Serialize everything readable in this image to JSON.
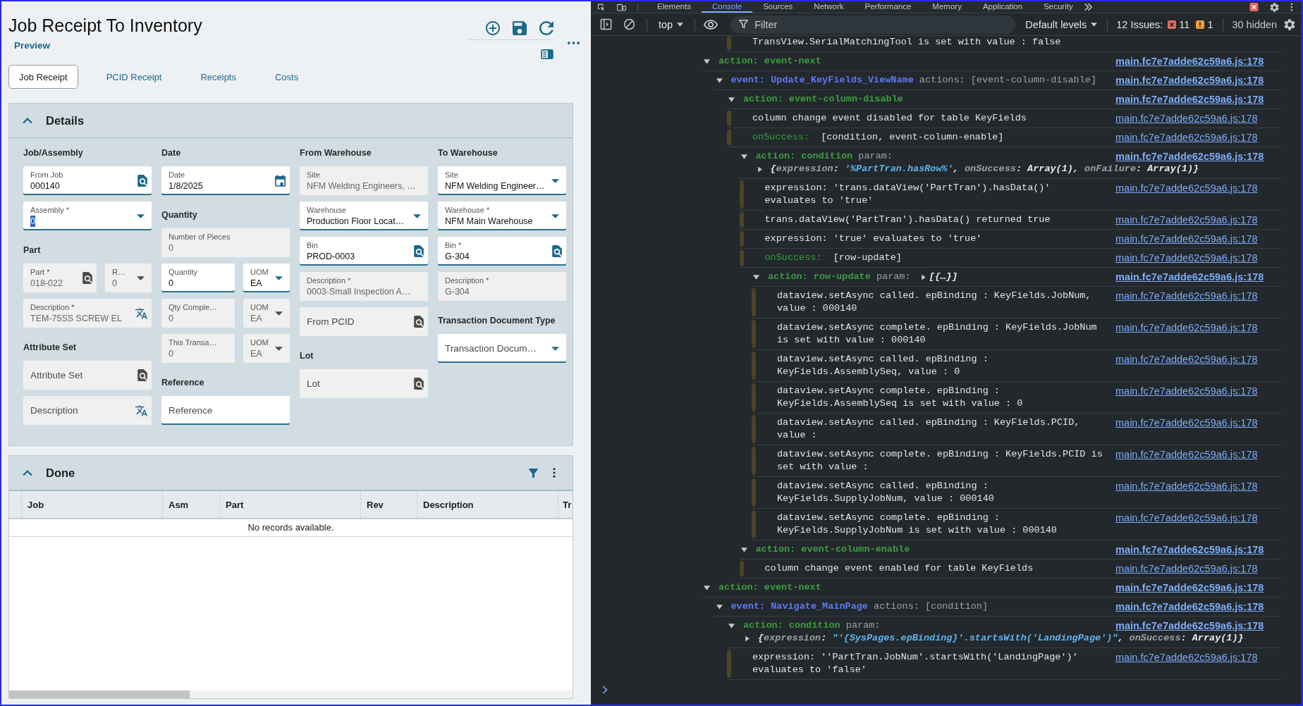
{
  "app": {
    "title": "Job Receipt To Inventory",
    "subtitle": "Preview",
    "tabs": [
      {
        "label": "Job Receipt",
        "selected": true
      },
      {
        "label": "PCID Receipt",
        "selected": false
      },
      {
        "label": "Receipts",
        "selected": false
      },
      {
        "label": "Costs",
        "selected": false
      }
    ],
    "details": {
      "title": "Details",
      "expanded": true,
      "columns": [
        {
          "sections": [
            {
              "heading": "Job/Assembly",
              "rows": [
                {
                  "fields": [
                    {
                      "kind": "lookup",
                      "label": "From Job",
                      "value": "000140",
                      "disabled": false,
                      "text_selected": false
                    }
                  ]
                },
                {
                  "fields": [
                    {
                      "kind": "dropdown",
                      "label": "Assembly *",
                      "value": "0",
                      "disabled": false,
                      "text_selected": true
                    }
                  ]
                }
              ]
            },
            {
              "heading": "Part",
              "rows": [
                {
                  "fields": [
                    {
                      "kind": "lookup",
                      "label": "Part *",
                      "value": "018-022",
                      "disabled": true,
                      "text_selected": false
                    },
                    {
                      "kind": "dropdown",
                      "label": "R…",
                      "value": "0",
                      "disabled": true,
                      "text_selected": false
                    }
                  ]
                },
                {
                  "fields": [
                    {
                      "kind": "translate",
                      "label": "Description *",
                      "value": "TEM-75SS SCREW EL",
                      "disabled": true,
                      "text_selected": false
                    }
                  ]
                }
              ]
            },
            {
              "heading": "Attribute Set",
              "rows": [
                {
                  "fields": [
                    {
                      "kind": "lookup",
                      "placeholder": "Attribute Set",
                      "disabled": true
                    }
                  ]
                },
                {
                  "fields": [
                    {
                      "kind": "translate",
                      "placeholder": "Description",
                      "disabled": true
                    }
                  ]
                }
              ]
            }
          ]
        },
        {
          "sections": [
            {
              "heading": "Date",
              "rows": [
                {
                  "fields": [
                    {
                      "kind": "date",
                      "label": "Date",
                      "value": "1/8/2025",
                      "disabled": false,
                      "text_selected": false
                    }
                  ]
                }
              ]
            },
            {
              "heading": "Quantity",
              "rows": [
                {
                  "fields": [
                    {
                      "kind": "text",
                      "label": "Number of Pieces",
                      "value": "0",
                      "disabled": true,
                      "text_selected": false
                    }
                  ]
                },
                {
                  "fields": [
                    {
                      "kind": "text",
                      "label": "Quantity",
                      "value": "0",
                      "disabled": false,
                      "text_selected": false
                    },
                    {
                      "kind": "dropdown",
                      "label": "UOM",
                      "value": "EA",
                      "disabled": false,
                      "text_selected": false
                    }
                  ]
                },
                {
                  "fields": [
                    {
                      "kind": "text",
                      "label": "Qty Comple…",
                      "value": "0",
                      "disabled": true,
                      "text_selected": false
                    },
                    {
                      "kind": "dropdown",
                      "label": "UOM",
                      "value": "EA",
                      "disabled": true,
                      "text_selected": false
                    }
                  ]
                },
                {
                  "fields": [
                    {
                      "kind": "text",
                      "label": "This Transa…",
                      "value": "0",
                      "disabled": true,
                      "text_selected": false
                    },
                    {
                      "kind": "dropdown",
                      "label": "UOM",
                      "value": "EA",
                      "disabled": true,
                      "text_selected": false
                    }
                  ]
                }
              ]
            },
            {
              "heading": "Reference",
              "rows": [
                {
                  "fields": [
                    {
                      "kind": "text",
                      "placeholder": "Reference",
                      "disabled": false
                    }
                  ]
                }
              ]
            }
          ]
        },
        {
          "sections": [
            {
              "heading": "From Warehouse",
              "rows": [
                {
                  "fields": [
                    {
                      "kind": "text",
                      "label": "Site",
                      "value": "NFM Welding Engineers, …",
                      "disabled": true,
                      "text_selected": false
                    }
                  ]
                },
                {
                  "fields": [
                    {
                      "kind": "dropdown",
                      "label": "Warehouse",
                      "value": "Production Floor Locat…",
                      "disabled": false,
                      "text_selected": false
                    }
                  ]
                },
                {
                  "fields": [
                    {
                      "kind": "lookup",
                      "label": "Bin",
                      "value": "PROD-0003",
                      "disabled": false,
                      "text_selected": false
                    }
                  ]
                },
                {
                  "fields": [
                    {
                      "kind": "text",
                      "label": "Description *",
                      "value": "0003-Small Inspection A…",
                      "disabled": true,
                      "text_selected": false
                    }
                  ]
                },
                {
                  "fields": [
                    {
                      "kind": "lookup",
                      "placeholder": "From PCID",
                      "disabled": true
                    }
                  ]
                }
              ]
            },
            {
              "heading": "Lot",
              "rows": [
                {
                  "fields": [
                    {
                      "kind": "lookup",
                      "placeholder": "Lot",
                      "disabled": true
                    }
                  ]
                }
              ]
            }
          ]
        },
        {
          "sections": [
            {
              "heading": "To Warehouse",
              "rows": [
                {
                  "fields": [
                    {
                      "kind": "dropdown",
                      "label": "Site",
                      "value": "NFM Welding Engineer…",
                      "disabled": false,
                      "text_selected": false
                    }
                  ]
                },
                {
                  "fields": [
                    {
                      "kind": "dropdown",
                      "label": "Warehouse *",
                      "value": "NFM Main Warehouse",
                      "disabled": false,
                      "text_selected": false
                    }
                  ]
                },
                {
                  "fields": [
                    {
                      "kind": "lookup",
                      "label": "Bin *",
                      "value": "G-304",
                      "disabled": false,
                      "text_selected": false
                    }
                  ]
                },
                {
                  "fields": [
                    {
                      "kind": "text",
                      "label": "Description *",
                      "value": "G-304",
                      "disabled": true,
                      "text_selected": false
                    }
                  ]
                }
              ]
            },
            {
              "heading": "Transaction Document Type",
              "rows": [
                {
                  "fields": [
                    {
                      "kind": "dropdown",
                      "placeholder": "Transaction Docum…",
                      "disabled": false
                    }
                  ]
                }
              ]
            }
          ]
        }
      ]
    },
    "done": {
      "title": "Done",
      "expanded": true,
      "columns": [
        "Job",
        "Asm",
        "Part",
        "Rev",
        "Description",
        "Tr"
      ],
      "empty_text": "No records available."
    }
  },
  "devtools": {
    "tabs": [
      {
        "label": "Elements",
        "selected": false
      },
      {
        "label": "Console",
        "selected": true
      },
      {
        "label": "Sources",
        "selected": false
      },
      {
        "label": "Network",
        "selected": false
      },
      {
        "label": "Performance",
        "selected": false
      },
      {
        "label": "Memory",
        "selected": false
      },
      {
        "label": "Application",
        "selected": false
      },
      {
        "label": "Security",
        "selected": false
      }
    ],
    "toolbar": {
      "context": "top",
      "filter_placeholder": "Filter",
      "levels": "Default levels",
      "issues": {
        "label": "12 Issues:",
        "counts": [
          {
            "kind": "error",
            "count": "11"
          },
          {
            "kind": "warning",
            "count": "1"
          }
        ]
      },
      "hidden": "30 hidden"
    },
    "console": {
      "entries": [
        {
          "kind": "continued",
          "children": [
            {
              "kind": "continued",
              "children": [
                {
                  "kind": "continued",
                  "children": [
                    {
                      "kind": "log",
                      "text": "TransView.SerialMatchingTool is set with value : false"
                    }
                  ]
                }
              ]
            }
          ]
        },
        {
          "kind": "action",
          "label": "action: event-next",
          "expanded": true,
          "source": "main.fc7e7adde62c59a6.js:178",
          "children": [
            {
              "kind": "event",
              "label": "event: Update_KeyFields_ViewName",
              "suffix": "actions: [event-column-disable]",
              "expanded": true,
              "source": "main.fc7e7adde62c59a6.js:178",
              "children": [
                {
                  "kind": "action",
                  "label": "action: event-column-disable",
                  "expanded": true,
                  "source": "main.fc7e7adde62c59a6.js:178",
                  "children": [
                    {
                      "kind": "log",
                      "text": "column change event disabled for table KeyFields",
                      "source": "main.fc7e7adde62c59a6.js:178"
                    },
                    {
                      "kind": "success",
                      "key": "onSuccess:",
                      "text": "[condition, event-column-enable]",
                      "source": "main.fc7e7adde62c59a6.js:178"
                    },
                    {
                      "kind": "action",
                      "label": "action: condition",
                      "suffix": "param:",
                      "param": {
                        "kind": "block",
                        "expanded": false,
                        "segments": [
                          {
                            "kind": "plain",
                            "text": "{"
                          },
                          {
                            "kind": "key",
                            "text": "expression"
                          },
                          {
                            "kind": "plain",
                            "text": ": "
                          },
                          {
                            "kind": "string",
                            "text": "'%PartTran.hasRow%'"
                          },
                          {
                            "kind": "plain",
                            "text": ", "
                          },
                          {
                            "kind": "key",
                            "text": "onSuccess"
                          },
                          {
                            "kind": "plain",
                            "text": ": Array(1), "
                          },
                          {
                            "kind": "key",
                            "text": "onFailure"
                          },
                          {
                            "kind": "plain",
                            "text": ": Array(1)}"
                          }
                        ]
                      },
                      "expanded": true,
                      "source": "main.fc7e7adde62c59a6.js:178",
                      "children": [
                        {
                          "kind": "log",
                          "text": "expression: 'trans.dataView('PartTran').hasData()'\nevaluates to 'true'",
                          "source": "main.fc7e7adde62c59a6.js:178"
                        },
                        {
                          "kind": "log",
                          "text": "trans.dataView('PartTran').hasData() returned true",
                          "source": "main.fc7e7adde62c59a6.js:178"
                        },
                        {
                          "kind": "log",
                          "text": "expression: 'true' evaluates to 'true'",
                          "source": "main.fc7e7adde62c59a6.js:178"
                        },
                        {
                          "kind": "success",
                          "key": "onSuccess:",
                          "text": "[row-update]",
                          "source": "main.fc7e7adde62c59a6.js:178"
                        },
                        {
                          "kind": "action",
                          "label": "action: row-update",
                          "suffix": "param:",
                          "param": {
                            "kind": "inline",
                            "expanded": false,
                            "segments": [
                              {
                                "kind": "plain",
                                "text": "[{…}]"
                              }
                            ]
                          },
                          "expanded": true,
                          "source": "main.fc7e7adde62c59a6.js:178",
                          "children": [
                            {
                              "kind": "log",
                              "text": "dataview.setAsync called. epBinding : KeyFields.JobNum,\nvalue : 000140",
                              "source": "main.fc7e7adde62c59a6.js:178"
                            },
                            {
                              "kind": "log",
                              "text": "dataview.setAsync complete. epBinding : KeyFields.JobNum\nis set with value : 000140",
                              "source": "main.fc7e7adde62c59a6.js:178"
                            },
                            {
                              "kind": "log",
                              "text": "dataview.setAsync called. epBinding :\nKeyFields.AssemblySeq, value : 0",
                              "source": "main.fc7e7adde62c59a6.js:178"
                            },
                            {
                              "kind": "log",
                              "text": "dataview.setAsync complete. epBinding :\nKeyFields.AssemblySeq is set with value : 0",
                              "source": "main.fc7e7adde62c59a6.js:178"
                            },
                            {
                              "kind": "log",
                              "text": "dataview.setAsync called. epBinding : KeyFields.PCID,\nvalue :",
                              "source": "main.fc7e7adde62c59a6.js:178"
                            },
                            {
                              "kind": "log",
                              "text": "dataview.setAsync complete. epBinding : KeyFields.PCID is\nset with value :",
                              "source": "main.fc7e7adde62c59a6.js:178"
                            },
                            {
                              "kind": "log",
                              "text": "dataview.setAsync called. epBinding :\nKeyFields.SupplyJobNum, value : 000140",
                              "source": "main.fc7e7adde62c59a6.js:178"
                            },
                            {
                              "kind": "log",
                              "text": "dataview.setAsync complete. epBinding :\nKeyFields.SupplyJobNum is set with value : 000140",
                              "source": "main.fc7e7adde62c59a6.js:178"
                            }
                          ]
                        }
                      ]
                    },
                    {
                      "kind": "action",
                      "label": "action: event-column-enable",
                      "expanded": true,
                      "source": "main.fc7e7adde62c59a6.js:178",
                      "children": [
                        {
                          "kind": "log",
                          "text": "column change event enabled for table KeyFields",
                          "source": "main.fc7e7adde62c59a6.js:178"
                        }
                      ]
                    }
                  ]
                }
              ]
            }
          ]
        },
        {
          "kind": "action",
          "label": "action: event-next",
          "expanded": true,
          "source": "main.fc7e7adde62c59a6.js:178",
          "children": [
            {
              "kind": "event",
              "label": "event: Navigate_MainPage",
              "suffix": "actions: [condition]",
              "expanded": true,
              "source": "main.fc7e7adde62c59a6.js:178",
              "children": [
                {
                  "kind": "action",
                  "label": "action: condition",
                  "suffix": "param:",
                  "param": {
                    "kind": "block",
                    "expanded": false,
                    "segments": [
                      {
                        "kind": "plain",
                        "text": "{"
                      },
                      {
                        "kind": "key",
                        "text": "expression"
                      },
                      {
                        "kind": "plain",
                        "text": ": "
                      },
                      {
                        "kind": "string",
                        "text": "\"'{SysPages.epBinding}'.startsWith('LandingPage')\""
                      },
                      {
                        "kind": "plain",
                        "text": ", "
                      },
                      {
                        "kind": "key",
                        "text": "onSuccess"
                      },
                      {
                        "kind": "plain",
                        "text": ": Array(1)}"
                      }
                    ]
                  },
                  "expanded": true,
                  "source": "main.fc7e7adde62c59a6.js:178",
                  "children": [
                    {
                      "kind": "log",
                      "text": "expression: ''PartTran.JobNum'.startsWith('LandingPage')'\nevaluates to 'false'",
                      "source": "main.fc7e7adde62c59a6.js:178"
                    }
                  ]
                }
              ]
            }
          ]
        }
      ]
    }
  }
}
